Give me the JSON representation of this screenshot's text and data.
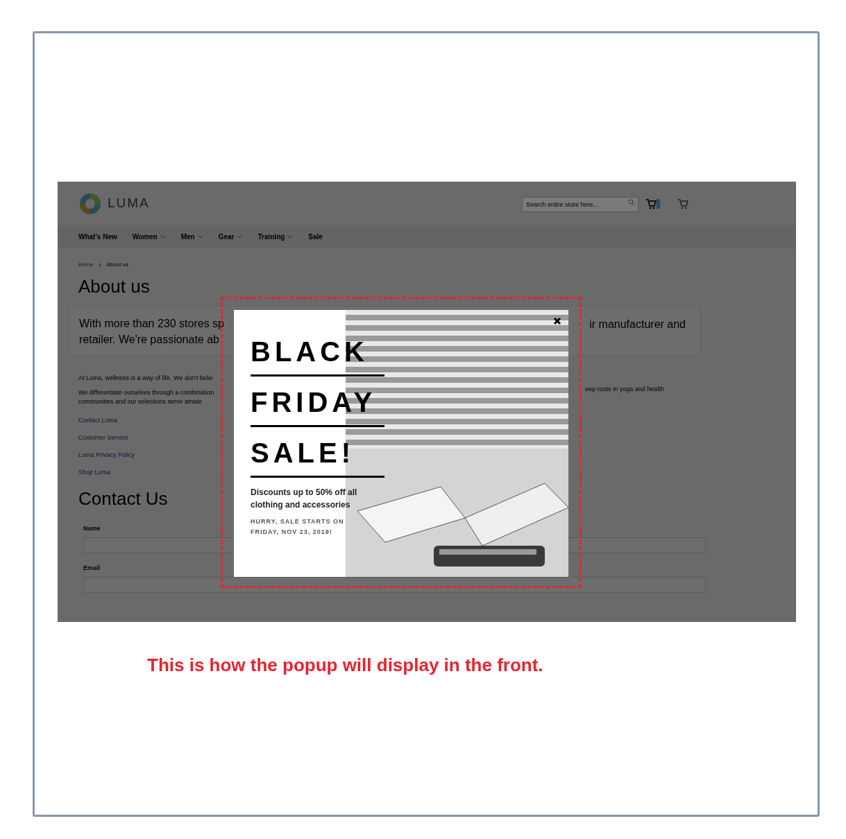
{
  "store": {
    "logo_text": "LUMA",
    "search": {
      "placeholder": "Search entire store here..."
    },
    "nav": [
      {
        "label": "What's New",
        "dropdown": false
      },
      {
        "label": "Women",
        "dropdown": true
      },
      {
        "label": "Men",
        "dropdown": true
      },
      {
        "label": "Gear",
        "dropdown": true
      },
      {
        "label": "Training",
        "dropdown": true
      },
      {
        "label": "Sale",
        "dropdown": false
      }
    ],
    "breadcrumb": {
      "separator": "›",
      "items": [
        "Home",
        "About us"
      ]
    },
    "page_title": "About us",
    "intro": {
      "left_lines": [
        "With more than 230 stores sp",
        "retailer. We're passionate ab"
      ],
      "right": "ir manufacturer and"
    },
    "body": {
      "left_lines": [
        "At Luma, wellness is a way of life. We don't belie",
        "We differentiate ourselves through a combination",
        "communities and our selections serve amate"
      ],
      "right": "eep roots in yoga and health"
    },
    "links": [
      "Contact Luma",
      "Customer Service",
      "Luma Privacy Policy",
      "Shop Luma"
    ],
    "contact": {
      "title": "Contact Us",
      "fields": [
        {
          "label": "Name"
        },
        {
          "label": "Email"
        }
      ]
    }
  },
  "popup": {
    "headline": [
      "BLACK",
      "FRIDAY",
      "SALE!"
    ],
    "text": "Discounts up to 50% off all clothing and accessories",
    "note": "HURRY, SALE STARTS ON FRIDAY, NOV 23, 2019!"
  },
  "caption": "This is how the popup will display in the front."
}
